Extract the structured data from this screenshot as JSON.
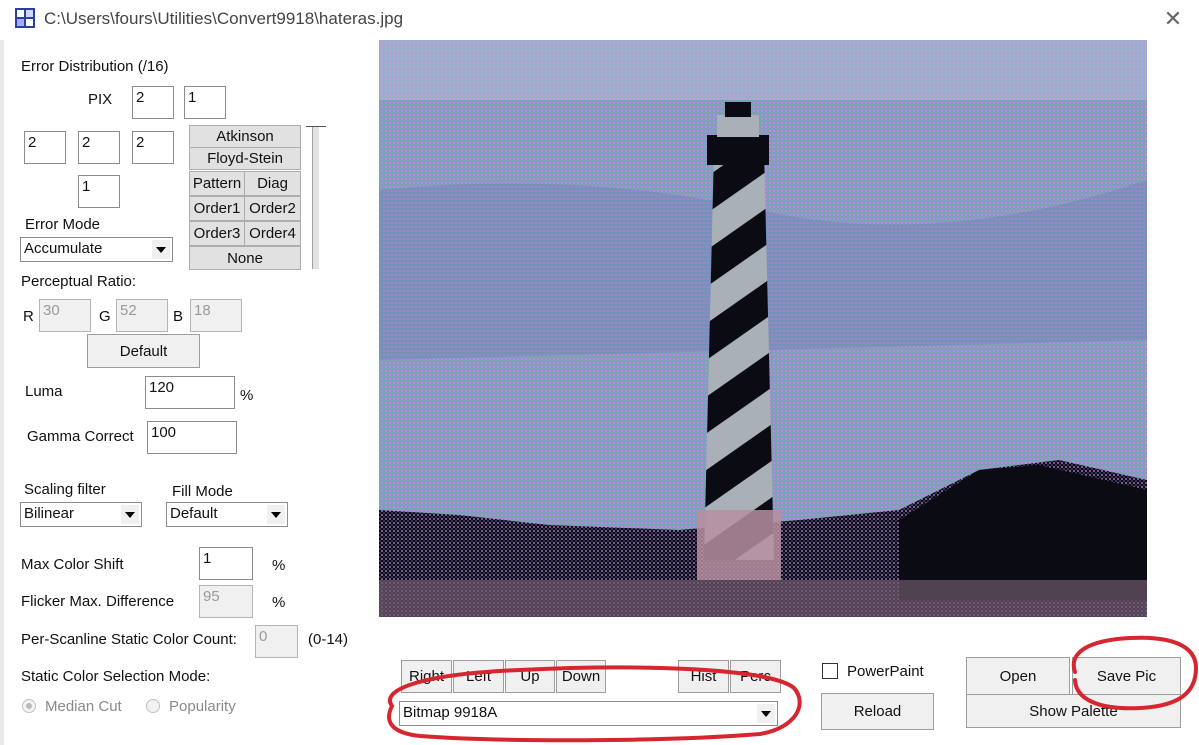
{
  "window": {
    "title": "C:\\Users\\fours\\Utilities\\Convert9918\\hateras.jpg",
    "close_glyph": "✕",
    "icon": "app-icon"
  },
  "error_distribution": {
    "heading": "Error Distribution (/16)",
    "pix_label": "PIX",
    "pix_right": "2",
    "pix_far_right": "1",
    "row2": [
      "2",
      "2",
      "2"
    ],
    "below": "1"
  },
  "dither_buttons": {
    "atkinson": "Atkinson",
    "floyd_stein": "Floyd-Stein",
    "pattern": "Pattern",
    "diag": "Diag",
    "order1": "Order1",
    "order2": "Order2",
    "order3": "Order3",
    "order4": "Order4",
    "none": "None"
  },
  "error_mode": {
    "label": "Error Mode",
    "value": "Accumulate"
  },
  "perceptual": {
    "label": "Perceptual Ratio:",
    "r_label": "R",
    "r_value": "30",
    "g_label": "G",
    "g_value": "52",
    "b_label": "B",
    "b_value": "18",
    "default_button": "Default"
  },
  "luma": {
    "label": "Luma",
    "value": "120",
    "unit": "%"
  },
  "gamma": {
    "label": "Gamma Correct",
    "value": "100"
  },
  "scaling": {
    "label": "Scaling filter",
    "value": "Bilinear"
  },
  "fill_mode": {
    "label": "Fill Mode",
    "value": "Default"
  },
  "max_color_shift": {
    "label": "Max Color Shift",
    "value": "1",
    "unit": "%"
  },
  "flicker": {
    "label": "Flicker Max. Difference",
    "value": "95",
    "unit": "%"
  },
  "static_count": {
    "label": "Per-Scanline Static Color Count:",
    "value": "0",
    "range": "(0-14)"
  },
  "static_mode": {
    "label": "Static Color Selection Mode:",
    "median_cut": "Median Cut",
    "popularity": "Popularity"
  },
  "nav": {
    "right": "Right",
    "left": "Left",
    "up": "Up",
    "down": "Down"
  },
  "hist_perc": {
    "hist": "Hist",
    "perc": "Perc"
  },
  "format": {
    "value": "Bitmap 9918A"
  },
  "powerpaint": {
    "label": "PowerPaint",
    "checked": false
  },
  "actions": {
    "reload": "Reload",
    "open": "Open",
    "save_pic": "Save Pic",
    "show_palette": "Show Palette"
  },
  "annotation_color": "#d6262f",
  "preview_colors": {
    "sky": "#8a94c9",
    "dither_a": "#6fb0a0",
    "dither_b": "#b38fd9",
    "dark": "#0b0b14",
    "stripe": "#aab0b8"
  }
}
